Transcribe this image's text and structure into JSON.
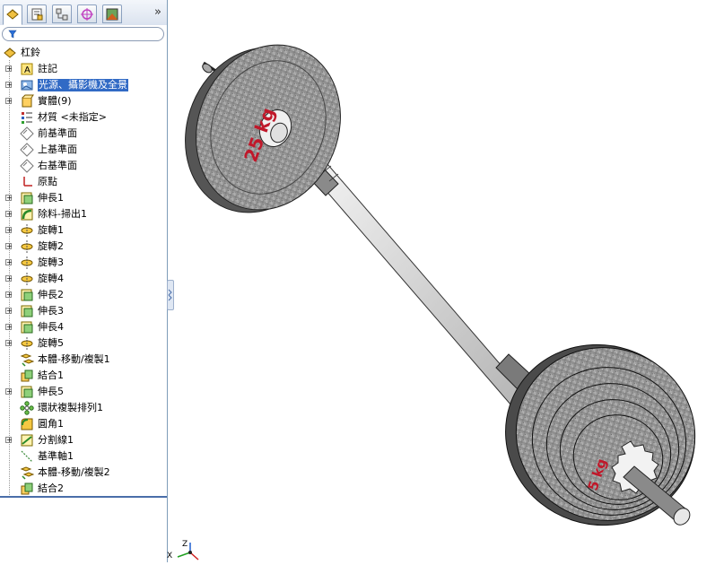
{
  "feature_tree": {
    "root": {
      "label": "杠鈴",
      "icon": "part-icon"
    },
    "items": [
      {
        "label": "註記",
        "icon": "annotations-icon",
        "expandable": true
      },
      {
        "label": "光源、攝影機及全景",
        "icon": "lights-cameras-icon",
        "expandable": true,
        "selected": true
      },
      {
        "label": "實體(9)",
        "icon": "solid-bodies-icon",
        "expandable": true
      },
      {
        "label": "材質 <未指定>",
        "icon": "material-icon",
        "expandable": false
      },
      {
        "label": "前基準面",
        "icon": "plane-icon",
        "expandable": false
      },
      {
        "label": "上基準面",
        "icon": "plane-icon",
        "expandable": false
      },
      {
        "label": "右基準面",
        "icon": "plane-icon",
        "expandable": false
      },
      {
        "label": "原點",
        "icon": "origin-icon",
        "expandable": false
      },
      {
        "label": "伸長1",
        "icon": "extrude-icon",
        "expandable": true
      },
      {
        "label": "除料-掃出1",
        "icon": "swept-cut-icon",
        "expandable": true
      },
      {
        "label": "旋轉1",
        "icon": "revolve-icon",
        "expandable": true
      },
      {
        "label": "旋轉2",
        "icon": "revolve-icon",
        "expandable": true
      },
      {
        "label": "旋轉3",
        "icon": "revolve-icon",
        "expandable": true
      },
      {
        "label": "旋轉4",
        "icon": "revolve-icon",
        "expandable": true
      },
      {
        "label": "伸長2",
        "icon": "extrude-icon",
        "expandable": true
      },
      {
        "label": "伸長3",
        "icon": "extrude-icon",
        "expandable": true
      },
      {
        "label": "伸長4",
        "icon": "extrude-icon",
        "expandable": true
      },
      {
        "label": "旋轉5",
        "icon": "revolve-icon",
        "expandable": true
      },
      {
        "label": "本體-移動/複製1",
        "icon": "move-copy-icon",
        "expandable": false
      },
      {
        "label": "結合1",
        "icon": "combine-icon",
        "expandable": false
      },
      {
        "label": "伸長5",
        "icon": "extrude-icon",
        "expandable": true
      },
      {
        "label": "環狀複製排列1",
        "icon": "circular-pattern-icon",
        "expandable": false
      },
      {
        "label": "圓角1",
        "icon": "fillet-icon",
        "expandable": false
      },
      {
        "label": "分割線1",
        "icon": "split-line-icon",
        "expandable": true
      },
      {
        "label": "基準軸1",
        "icon": "axis-icon",
        "expandable": false
      },
      {
        "label": "本體-移動/複製2",
        "icon": "move-copy-icon",
        "expandable": false
      },
      {
        "label": "結合2",
        "icon": "combine-icon",
        "expandable": false
      }
    ]
  },
  "tabs": [
    {
      "name": "feature-manager-tab",
      "icon": "feature-manager-icon"
    },
    {
      "name": "property-manager-tab",
      "icon": "property-manager-icon"
    },
    {
      "name": "configuration-manager-tab",
      "icon": "configuration-manager-icon"
    },
    {
      "name": "dimxpert-tab",
      "icon": "dimxpert-icon"
    },
    {
      "name": "display-manager-tab",
      "icon": "display-manager-icon"
    }
  ],
  "tab_overflow": "»",
  "model": {
    "plate_label_top": "25 kg",
    "plate_label_bottom": "5 kg"
  },
  "triad": {
    "z": "Z",
    "x": "X"
  },
  "colors": {
    "selection": "#316ac5",
    "plate": "#8a8a8a",
    "plate_text": "#c0182a",
    "bar": "#d8d8d8"
  }
}
